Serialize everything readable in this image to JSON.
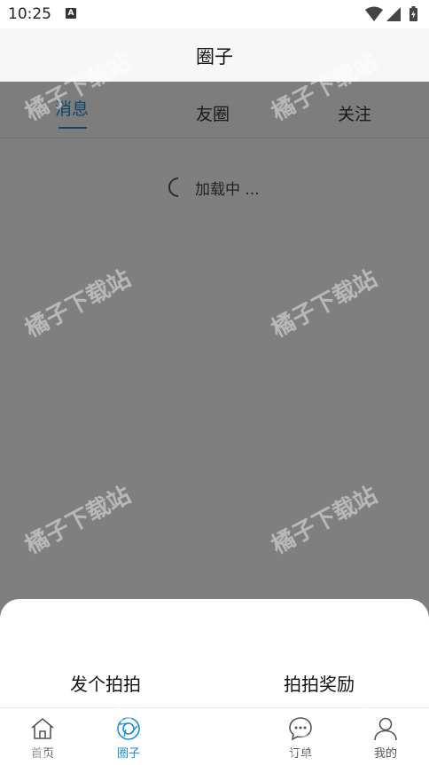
{
  "status_bar": {
    "time": "10:25",
    "notification_icon": "a-letter-icon",
    "wifi_icon": "wifi-icon",
    "signal_icon": "signal-icon",
    "battery_icon": "battery-charging-icon"
  },
  "header": {
    "title": "圈子"
  },
  "tabs": [
    {
      "label": "消息",
      "active": true
    },
    {
      "label": "友圈",
      "active": false
    },
    {
      "label": "关注",
      "active": false
    }
  ],
  "content": {
    "loading_text": "加载中 ..."
  },
  "sheet": {
    "options": [
      {
        "label": "发个拍拍"
      },
      {
        "label": "拍拍奖励"
      }
    ]
  },
  "bottom_nav": [
    {
      "label": "首页",
      "icon": "home-icon",
      "active": false
    },
    {
      "label": "圈子",
      "icon": "circle-icon",
      "active": true
    },
    {
      "label": "订单",
      "icon": "chat-bubble-icon",
      "active": false
    },
    {
      "label": "我的",
      "icon": "user-icon",
      "active": false
    }
  ],
  "watermark": {
    "text": "橘子下载站"
  },
  "colors": {
    "accent": "#1a8fd6",
    "overlay": "rgba(0,0,0,0.5)"
  }
}
